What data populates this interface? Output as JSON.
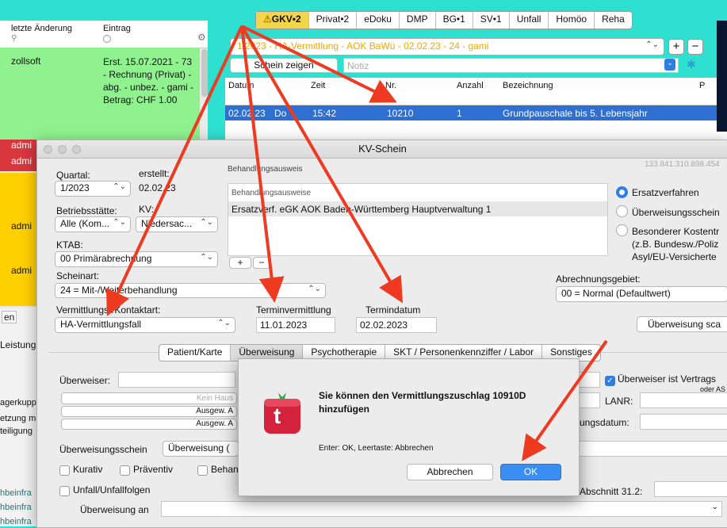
{
  "top_tabs": [
    {
      "label": "GKV•2",
      "active": true
    },
    {
      "label": "Privat•2",
      "active": false
    },
    {
      "label": "eDoku",
      "active": false
    },
    {
      "label": "DMP",
      "active": false
    },
    {
      "label": "BG•1",
      "active": false
    },
    {
      "label": "SV•1",
      "active": false
    },
    {
      "label": "Unfall",
      "active": false
    },
    {
      "label": "Homöo",
      "active": false
    },
    {
      "label": "Reha",
      "active": false
    }
  ],
  "left_list": {
    "col_change": "letzte Änderung",
    "col_entry": "Eintrag",
    "row1_user": "zollsoft",
    "row1_entry": "Erst. 15.07.2021 - 73 - Rechnung (Privat) - abg. - unbez. - gami - Betrag: CHF 1.00",
    "admin_rows": [
      "admi",
      "admi",
      "admi",
      "admi"
    ],
    "fragments": [
      "en",
      "Leistung",
      "agerkupp",
      "etzung m",
      "teiligung",
      "hbeinfra",
      "hbeinfra",
      "hbeinfra",
      "hbeinfra"
    ]
  },
  "card": {
    "selector_text": "1/2023 - HA-Vermittlung - AOK BaWü - 02.02.23 - 24 - gami",
    "schein_button": "Schein zeigen",
    "notiz_placeholder": "Notiz",
    "plus": "+",
    "minus": "−"
  },
  "table": {
    "headers": [
      "Datum",
      "Zeit",
      "Nr.",
      "Anzahl",
      "Bezeichnung",
      "P"
    ],
    "row": {
      "datum": "02.02.23",
      "tag": "Do",
      "zeit": "15:42",
      "nr": "10210",
      "anzahl": "1",
      "bezeichnung": "Grundpauschale bis 5. Lebensjahr"
    }
  },
  "kv": {
    "title": "KV-Schein",
    "id_number": "133.841.310.898.454",
    "quartal_label": "Quartal:",
    "quartal_value": "1/2023",
    "erstellt_label": "erstellt:",
    "erstellt_value": "02.02.23",
    "betrieb_label": "Betriebsstätte:",
    "betrieb_value": "Alle (Kom...",
    "kv_label": "KV:",
    "kv_value": "Niedersac...",
    "ktab_label": "KTAB:",
    "ktab_value": "00 Primärabrechnung",
    "scheinart_label": "Scheinart:",
    "scheinart_value": "24 = Mit-/Weiterbehandlung",
    "vermittlung_label": "Vermittlungs-/Kontaktart:",
    "vermittlung_value": "HA-Vermittlungsfall",
    "termin_label": "Terminvermittlung",
    "termin_value": "11.01.2023",
    "termindatum_label": "Termindatum",
    "termindatum_value": "02.02.2023",
    "behandlung_group": "Behandlungsausweis",
    "behandlung_header": "Behandlungsausweise",
    "behandlung_row": "Ersatzverf. eGK AOK Baden-Württemberg Hauptverwaltung 1",
    "radio_ersatz": "Ersatzverfahren",
    "radio_ueberweisung": "Überweisungsschein",
    "radio_besonderer": "Besonderer Kostentr",
    "radio_besonderer2": "(z.B. Bundesw./Poliz",
    "radio_besonderer3": "Asyl/EU-Versicherte",
    "abrechnung_label": "Abrechnungsgebiet:",
    "abrechnung_value": "00 = Normal (Defaultwert)",
    "ueberweisung_scan": "Überweisung sca",
    "tabs": [
      "Patient/Karte",
      "Überweisung",
      "Psychotherapie",
      "SKT / Personenkennziffer / Labor",
      "Sonstiges"
    ],
    "ueberweiser_label": "Überweiser:",
    "kein_haus": "Kein Haus",
    "ausgew1": "Ausgew. A",
    "ausgew2": "Ausgew. A",
    "vertrags_chk": "Überweiser ist Vertrags",
    "oder_as": "oder AS",
    "lanr_label": "LANR:",
    "ungsdatum_label": "ungsdatum:",
    "uschein_label": "Überweisungsschein",
    "uschein_value": "Überweisung (",
    "kurativ": "Kurativ",
    "praeventiv": "Präventiv",
    "behan": "Behan",
    "unfall": "Unfall/Unfallfolgen",
    "abschnitt_label": "Abschnitt 31.2:",
    "ueberweisung_an": "Überweisung an"
  },
  "dialog": {
    "message": "Sie können den Vermittlungszuschlag 10910D hinzufügen",
    "hint": "Enter: OK, Leertaste: Abbrechen",
    "cancel": "Abbrechen",
    "ok": "OK",
    "logo_letter": "t"
  },
  "colors": {
    "accent": "#2f7de0",
    "arrow": "#ef3a22",
    "teal": "#2ee0d0",
    "logo": "#d4213c",
    "gkv_active": "#f3d54a"
  }
}
